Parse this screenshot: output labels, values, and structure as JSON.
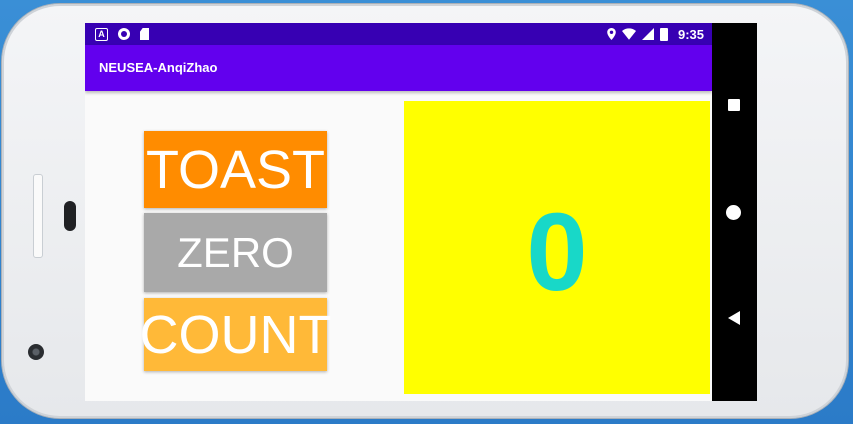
{
  "status_bar": {
    "time": "9:35",
    "left_icons": [
      "notification-a-icon",
      "record-circle-icon",
      "sd-card-icon"
    ],
    "right_icons": [
      "location-icon",
      "wifi-icon",
      "signal-icon",
      "battery-icon"
    ]
  },
  "app_bar": {
    "title": "NEUSEA-AnqiZhao",
    "color": "#6200ee",
    "status_color": "#3700b3"
  },
  "buttons": {
    "toast": {
      "label": "TOAST",
      "color": "#ff8c00"
    },
    "zero": {
      "label": "ZERO",
      "color": "#a9a9a9"
    },
    "count": {
      "label": "COUNT",
      "color": "#ffb938"
    }
  },
  "counter": {
    "value": "0",
    "background": "#ffff00",
    "text_color": "#18d8c8"
  },
  "nav_bar": {
    "items": [
      "recents-icon",
      "home-icon",
      "back-icon"
    ]
  }
}
